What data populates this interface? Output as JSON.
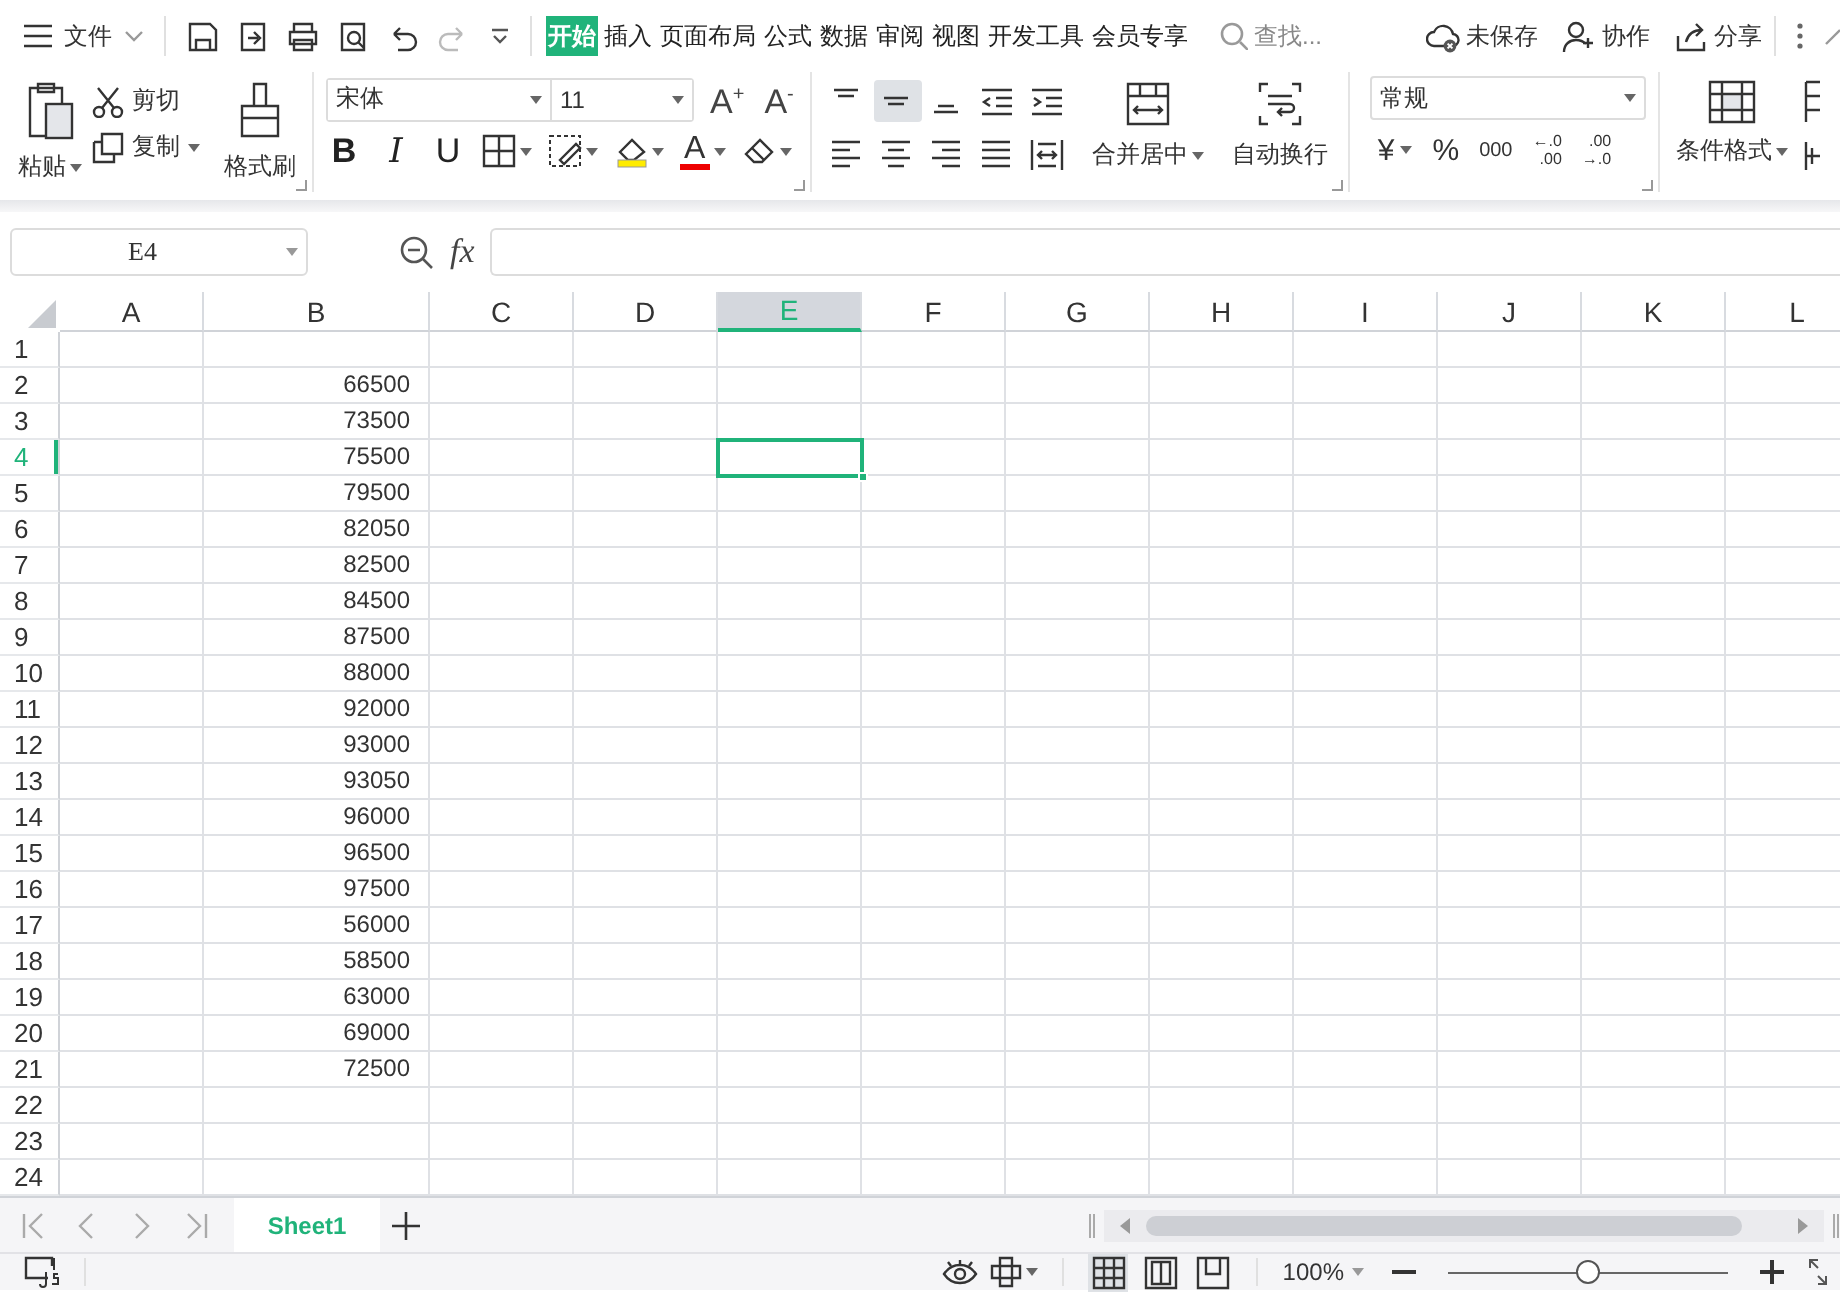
{
  "menu": {
    "file_label": "文件",
    "tabs": [
      {
        "label": "开始",
        "selected": true
      },
      {
        "label": "插入",
        "selected": false
      },
      {
        "label": "页面布局",
        "selected": false
      },
      {
        "label": "公式",
        "selected": false
      },
      {
        "label": "数据",
        "selected": false
      },
      {
        "label": "审阅",
        "selected": false
      },
      {
        "label": "视图",
        "selected": false
      },
      {
        "label": "开发工具",
        "selected": false
      },
      {
        "label": "会员专享",
        "selected": false
      }
    ],
    "search": {
      "placeholder": "查找..."
    },
    "actions": [
      {
        "kind": "cloud",
        "label": "未保存"
      },
      {
        "kind": "person",
        "label": "协作"
      },
      {
        "kind": "share",
        "label": "分享"
      }
    ]
  },
  "ribbon": {
    "paste": "粘贴",
    "cut": "剪切",
    "copy": "复制",
    "format_painter": "格式刷",
    "font": {
      "name": "宋体",
      "size": "11",
      "grow": "A$^{+}$",
      "shrink": "A$^{-}$",
      "bold": "B",
      "italic": "I",
      "underline": "U",
      "font_color": "A"
    },
    "merge": "合并居中",
    "wrap": "自动换行",
    "number_format": "常规",
    "currency": "¥",
    "percent": "%",
    "thousands": "000",
    "decimals": [
      {
        "top": "←.0",
        "bottom": ".00"
      },
      {
        "top": ".00",
        "bottom": "→.0"
      }
    ],
    "conditional_format": "条件格式"
  },
  "formula_bar": {
    "cell_ref": "E4",
    "fx_label": "fx"
  },
  "grid": {
    "columns": [
      {
        "label": "A",
        "selected": false
      },
      {
        "label": "B",
        "selected": false
      },
      {
        "label": "C",
        "selected": false
      },
      {
        "label": "D",
        "selected": false
      },
      {
        "label": "E",
        "selected": true
      },
      {
        "label": "F",
        "selected": false
      },
      {
        "label": "G",
        "selected": false
      },
      {
        "label": "H",
        "selected": false
      },
      {
        "label": "I",
        "selected": false
      },
      {
        "label": "J",
        "selected": false
      },
      {
        "label": "K",
        "selected": false
      },
      {
        "label": "L",
        "selected": false
      }
    ],
    "rows": [
      {
        "label": "1",
        "selected": false
      },
      {
        "label": "2",
        "selected": false,
        "column_b": "66500"
      },
      {
        "label": "3",
        "selected": false,
        "column_b": "73500"
      },
      {
        "label": "4",
        "selected": true,
        "column_b": "75500"
      },
      {
        "label": "5",
        "selected": false,
        "column_b": "79500"
      },
      {
        "label": "6",
        "selected": false,
        "column_b": "82050"
      },
      {
        "label": "7",
        "selected": false,
        "column_b": "82500"
      },
      {
        "label": "8",
        "selected": false,
        "column_b": "84500"
      },
      {
        "label": "9",
        "selected": false,
        "column_b": "87500"
      },
      {
        "label": "10",
        "selected": false,
        "column_b": "88000"
      },
      {
        "label": "11",
        "selected": false,
        "column_b": "92000"
      },
      {
        "label": "12",
        "selected": false,
        "column_b": "93000"
      },
      {
        "label": "13",
        "selected": false,
        "column_b": "93050"
      },
      {
        "label": "14",
        "selected": false,
        "column_b": "96000"
      },
      {
        "label": "15",
        "selected": false,
        "column_b": "96500"
      },
      {
        "label": "16",
        "selected": false,
        "column_b": "97500"
      },
      {
        "label": "17",
        "selected": false,
        "column_b": "56000"
      },
      {
        "label": "18",
        "selected": false,
        "column_b": "58500"
      },
      {
        "label": "19",
        "selected": false,
        "column_b": "63000"
      },
      {
        "label": "20",
        "selected": false,
        "column_b": "69000"
      },
      {
        "label": "21",
        "selected": false,
        "column_b": "72500"
      },
      {
        "label": "22",
        "selected": false
      },
      {
        "label": "23",
        "selected": false
      },
      {
        "label": "24",
        "selected": false
      }
    ]
  },
  "sheets": [
    {
      "label": "Sheet1",
      "selected": true
    }
  ],
  "status_bar": {
    "views": [
      {
        "kind": "normal",
        "selected": true
      },
      {
        "kind": "page",
        "selected": false
      },
      {
        "kind": "break",
        "selected": false
      }
    ],
    "zoom": "100%",
    "zoom_slider": {
      "level": 0.5
    }
  }
}
